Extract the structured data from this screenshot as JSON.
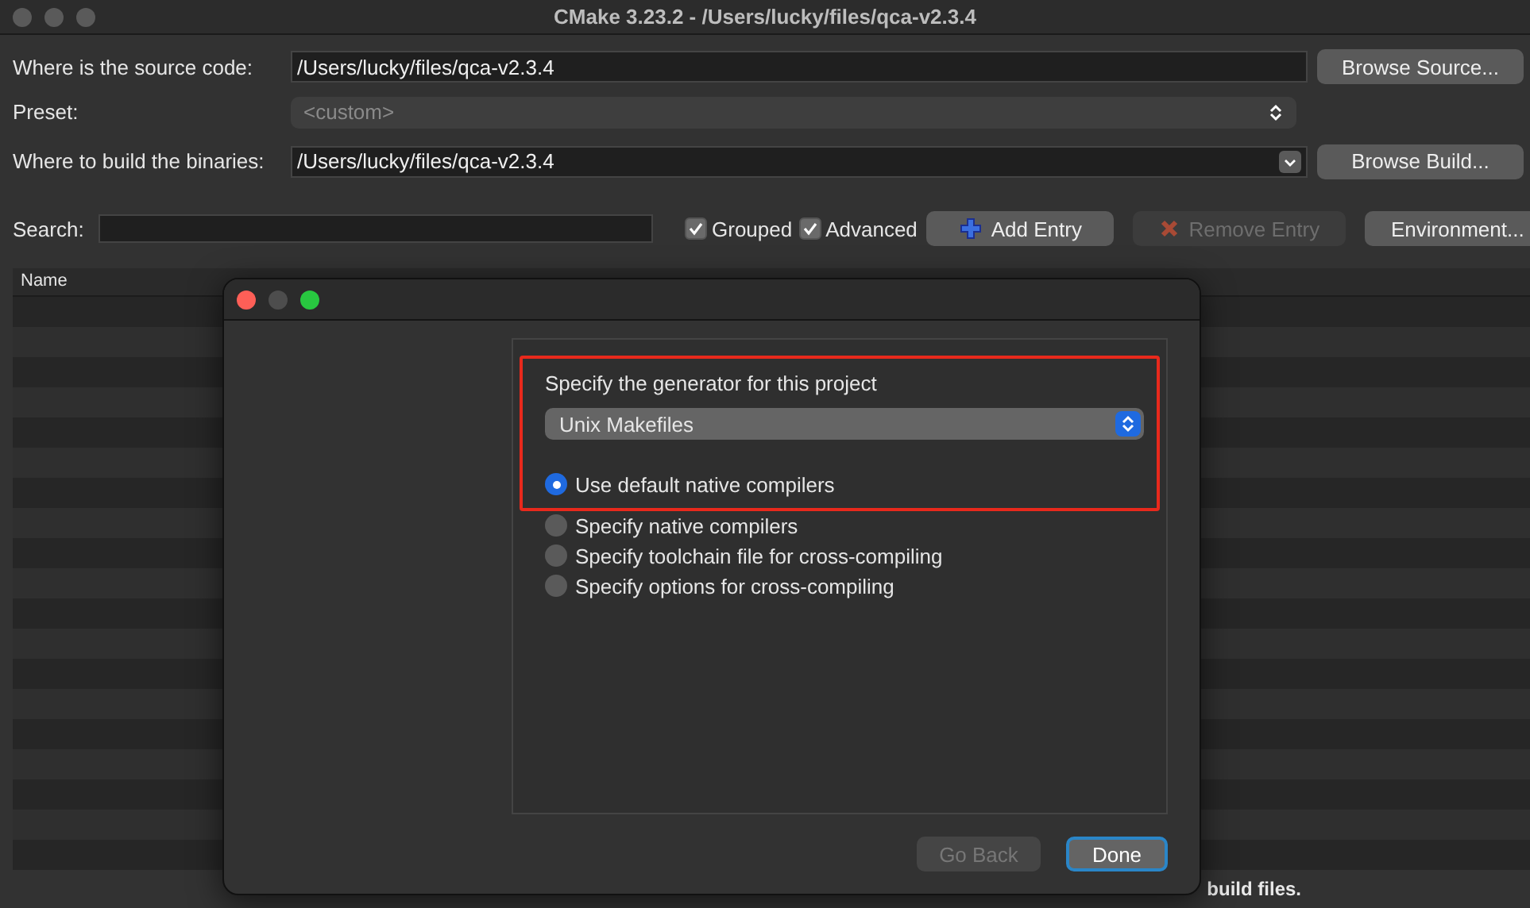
{
  "window": {
    "title": "CMake 3.23.2 - /Users/lucky/files/qca-v2.3.4"
  },
  "source": {
    "label": "Where is the source code:",
    "value": "/Users/lucky/files/qca-v2.3.4",
    "button": "Browse Source..."
  },
  "preset": {
    "label": "Preset:",
    "value": "<custom>",
    "disabled": true
  },
  "build": {
    "label": "Where to build the binaries:",
    "value": "/Users/lucky/files/qca-v2.3.4",
    "button": "Browse Build..."
  },
  "search": {
    "label": "Search:"
  },
  "options": [
    {
      "label": "Grouped",
      "checked": true
    },
    {
      "label": "Advanced",
      "checked": true
    }
  ],
  "toolbar": [
    {
      "label": "Add Entry",
      "kind": "plus",
      "disabled": false
    },
    {
      "label": "Remove Entry",
      "kind": "cross",
      "disabled": true
    },
    {
      "label": "Environment...",
      "kind": "plain",
      "disabled": false
    }
  ],
  "table": {
    "columns": [
      "Name"
    ]
  },
  "status_bar": "build files.",
  "dialog": {
    "prompt": "Specify the generator for this project",
    "generator": "Unix Makefiles",
    "highlighted": true,
    "choices": [
      {
        "label": "Use default native compilers",
        "selected": true
      },
      {
        "label": "Specify native compilers",
        "selected": false
      },
      {
        "label": "Specify toolchain file for cross-compiling",
        "selected": false
      },
      {
        "label": "Specify options for cross-compiling",
        "selected": false
      }
    ],
    "buttons": [
      {
        "label": "Go Back",
        "disabled": true,
        "default": false
      },
      {
        "label": "Done",
        "disabled": false,
        "default": true
      }
    ]
  }
}
